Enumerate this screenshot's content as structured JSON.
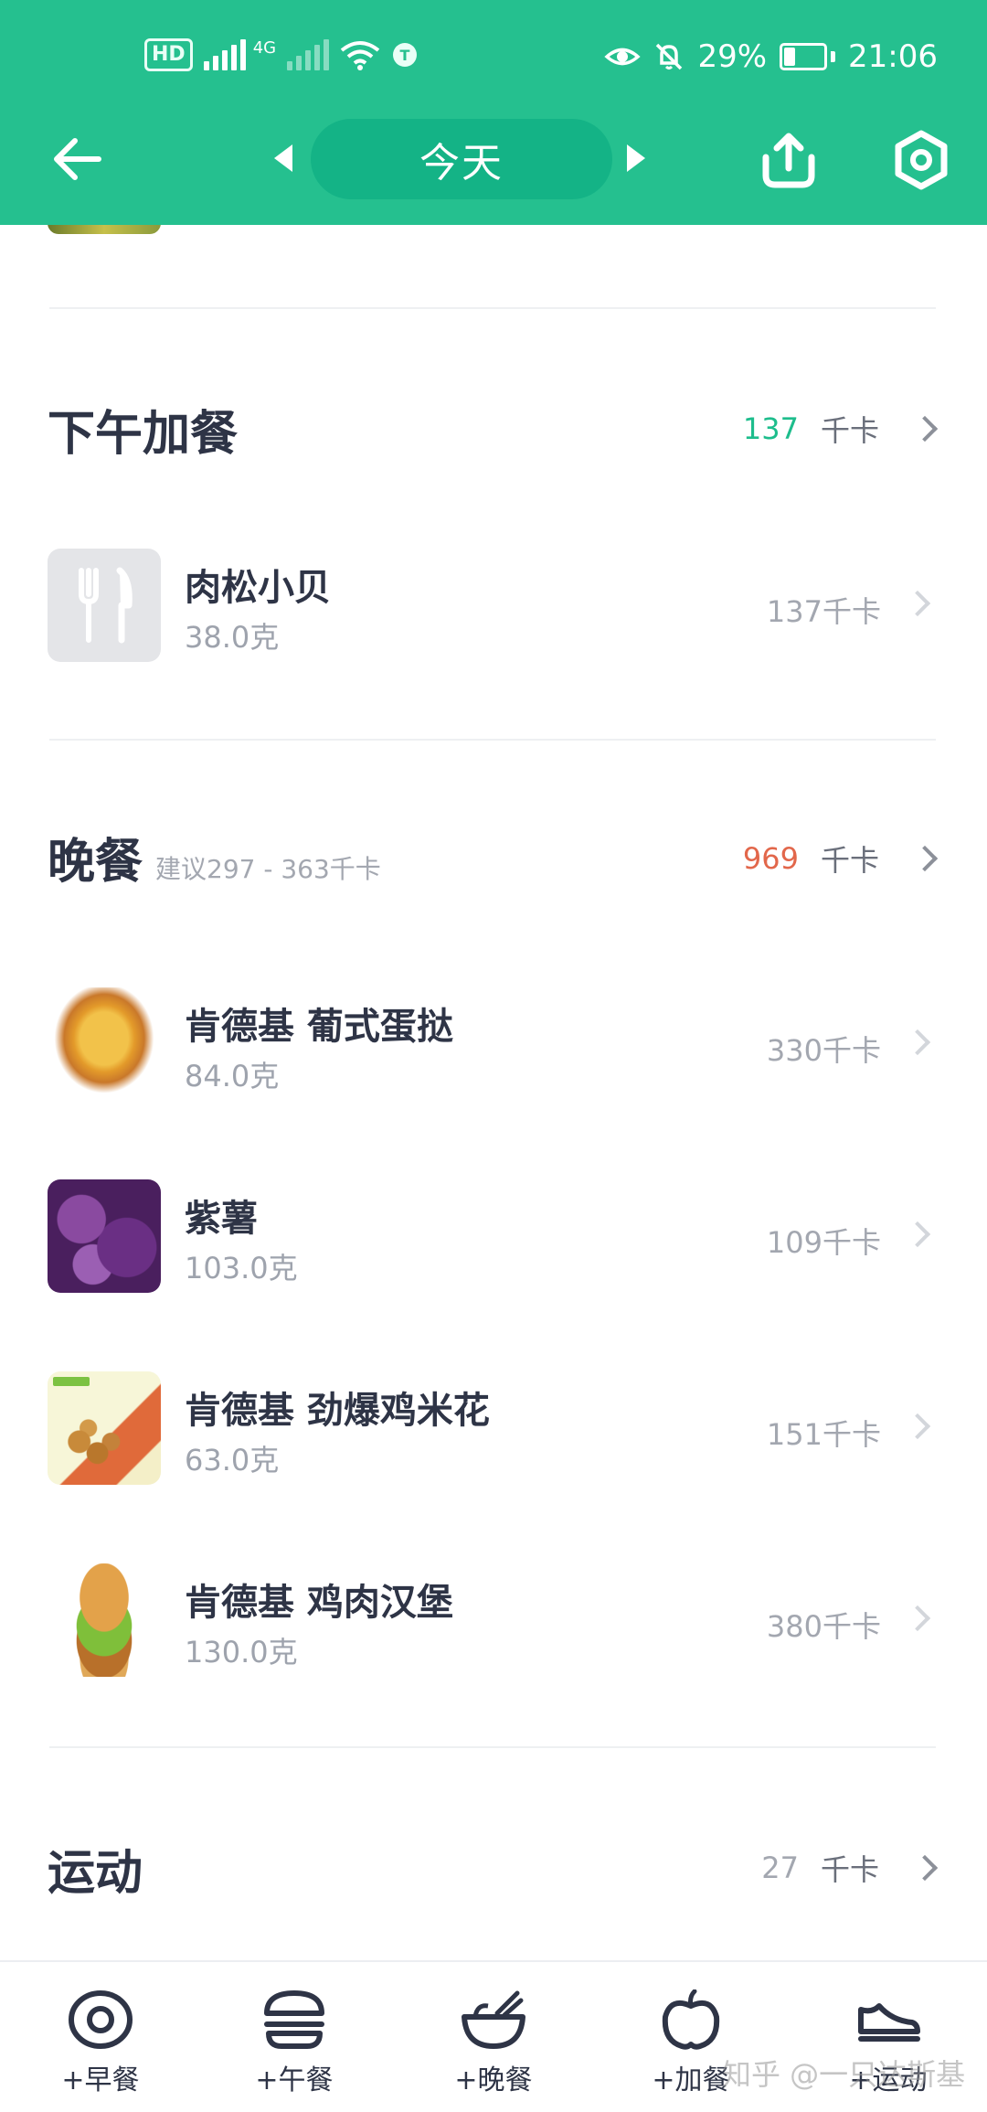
{
  "status_bar": {
    "hd_label": "HD",
    "network_label": "4G",
    "battery_percent": "29%",
    "battery_level": 0.29,
    "time": "21:06"
  },
  "header": {
    "date_label": "今天",
    "icons": [
      "back-arrow-icon",
      "prev-day-icon",
      "next-day-icon",
      "share-upload-icon",
      "settings-icon"
    ]
  },
  "sections": {
    "afternoon_snack": {
      "title": "下午加餐",
      "kcal": "137",
      "unit": "千卡",
      "kcal_color": "#1dbd8c",
      "items": [
        {
          "name": "肉松小贝",
          "amount": "38.0克",
          "kcal": "137千卡",
          "thumb": "fork-knife-placeholder"
        }
      ]
    },
    "dinner": {
      "title": "晚餐",
      "suggestion": "建议297 - 363千卡",
      "kcal": "969",
      "unit": "千卡",
      "kcal_color": "#e2674b",
      "items": [
        {
          "name": "肯德基 葡式蛋挞",
          "amount": "84.0克",
          "kcal": "330千卡",
          "thumb": "egg-tart"
        },
        {
          "name": "紫薯",
          "amount": "103.0克",
          "kcal": "109千卡",
          "thumb": "purple-sweet-potato"
        },
        {
          "name": "肯德基 劲爆鸡米花",
          "amount": "63.0克",
          "kcal": "151千卡",
          "thumb": "popcorn-chicken"
        },
        {
          "name": "肯德基 鸡肉汉堡",
          "amount": "130.0克",
          "kcal": "380千卡",
          "thumb": "chicken-burger"
        }
      ]
    },
    "exercise": {
      "title": "运动",
      "kcal": "27",
      "unit": "千卡",
      "kcal_color": "#a3a7b0"
    }
  },
  "bottom_bar": {
    "tabs": [
      {
        "label": "+早餐",
        "icon": "fried-egg-icon"
      },
      {
        "label": "+午餐",
        "icon": "burger-icon"
      },
      {
        "label": "+晚餐",
        "icon": "bowl-icon"
      },
      {
        "label": "+加餐",
        "icon": "apple-icon"
      },
      {
        "label": "+运动",
        "icon": "sneaker-icon"
      }
    ]
  },
  "watermark": "知乎 @一只达斯基",
  "colors": {
    "brand": "#25c08f",
    "brand_dark": "#14b386",
    "text_primary": "#2e3446",
    "text_muted": "#a3a7b0"
  }
}
